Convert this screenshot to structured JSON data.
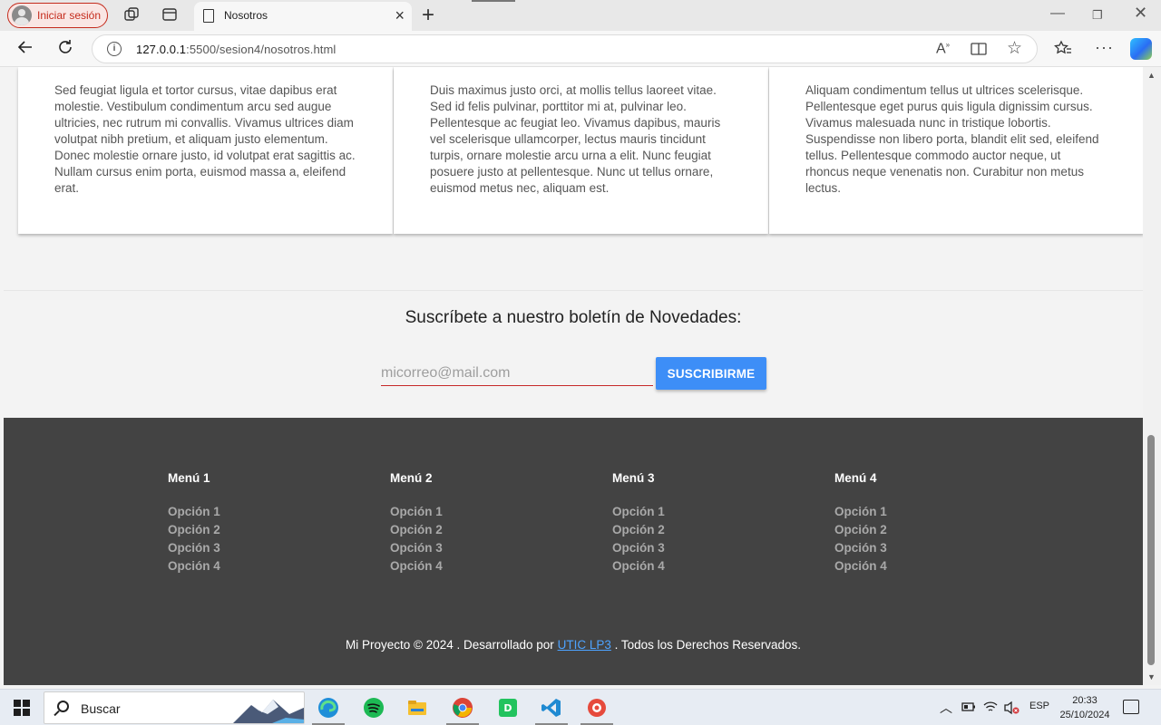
{
  "browser": {
    "signin_label": "Iniciar sesión",
    "tab_title": "Nosotros",
    "url_host": "127.0.0.1",
    "url_rest": ":5500/sesion4/nosotros.html"
  },
  "cards": [
    {
      "text": "Sed feugiat ligula et tortor cursus, vitae dapibus erat molestie. Vestibulum condimentum arcu sed augue ultricies, nec rutrum mi convallis. Vivamus ultrices diam volutpat nibh pretium, et aliquam justo elementum. Donec molestie ornare justo, id volutpat erat sagittis ac. Nullam cursus enim porta, euismod massa a, eleifend erat."
    },
    {
      "text": "Duis maximus justo orci, at mollis tellus laoreet vitae. Sed id felis pulvinar, porttitor mi at, pulvinar leo. Pellentesque ac feugiat leo. Vivamus dapibus, mauris vel scelerisque ullamcorper, lectus mauris tincidunt turpis, ornare molestie arcu urna a elit. Nunc feugiat posuere justo at pellentesque. Nunc ut tellus ornare, euismod metus nec, aliquam est."
    },
    {
      "text": "Aliquam condimentum tellus ut ultrices scelerisque. Pellentesque eget purus quis ligula dignissim cursus. Vivamus malesuada nunc in tristique lobortis. Suspendisse non libero porta, blandit elit sed, eleifend tellus. Pellentesque commodo auctor neque, ut rhoncus neque venenatis non. Curabitur non metus lectus."
    }
  ],
  "newsletter": {
    "title": "Suscríbete a nuestro boletín de Novedades:",
    "placeholder": "micorreo@mail.com",
    "button": "SUSCRIBIRME"
  },
  "footer": {
    "menus": [
      {
        "title": "Menú 1",
        "options": [
          "Opción 1",
          "Opción 2",
          "Opción 3",
          "Opción 4"
        ]
      },
      {
        "title": "Menú 2",
        "options": [
          "Opción 1",
          "Opción 2",
          "Opción 3",
          "Opción 4"
        ]
      },
      {
        "title": "Menú 3",
        "options": [
          "Opción 1",
          "Opción 2",
          "Opción 3",
          "Opción 4"
        ]
      },
      {
        "title": "Menú 4",
        "options": [
          "Opción 1",
          "Opción 2",
          "Opción 3",
          "Opción 4"
        ]
      }
    ],
    "copyright_prefix": "Mi Proyecto © 2024 . Desarrollado por",
    "copyright_link": "UTIC LP3",
    "copyright_suffix": ". Todos los Derechos Reservados."
  },
  "taskbar": {
    "search_label": "Buscar",
    "language": "ESP",
    "time": "20:33",
    "date": "25/10/2024"
  },
  "colors": {
    "accent_button": "#3d8ef7",
    "footer_bg": "#434343",
    "signin_red": "#c42b1c"
  }
}
